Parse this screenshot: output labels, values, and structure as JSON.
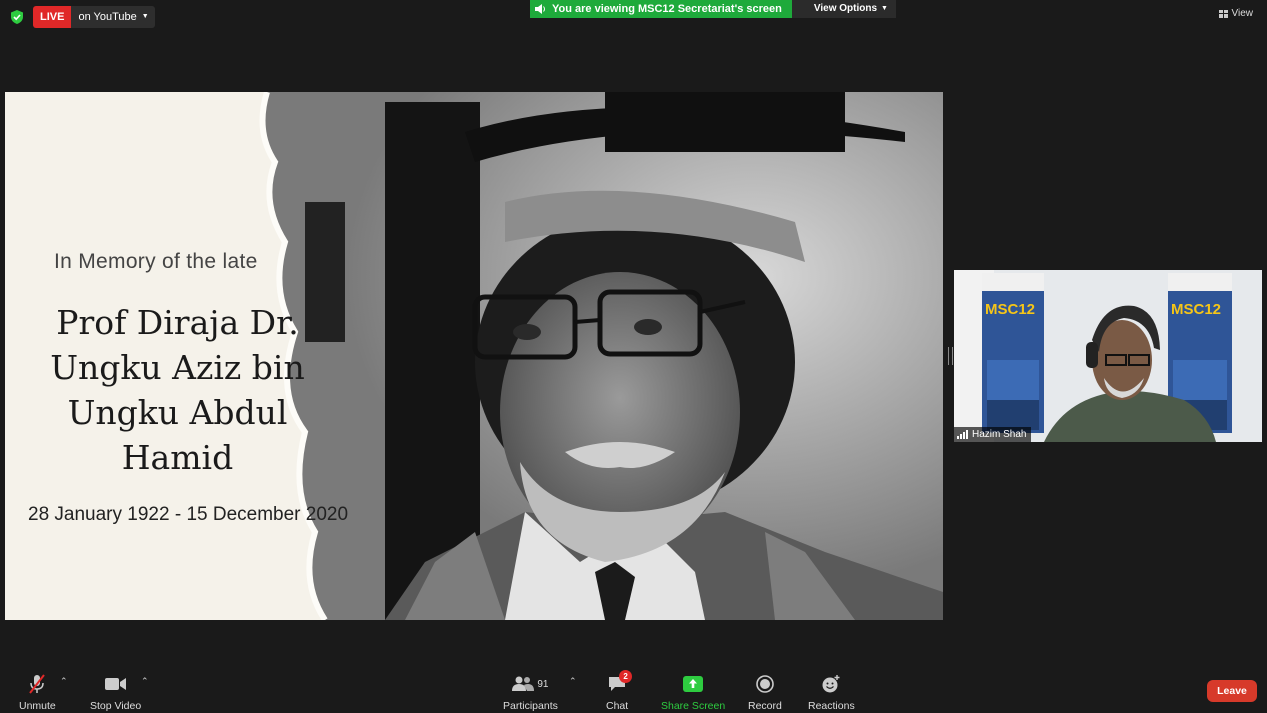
{
  "topbar": {
    "live_label": "LIVE",
    "live_target": "on YouTube",
    "viewing_text": "You are viewing MSC12 Secretariat's screen",
    "view_options": "View Options",
    "view_label": "View"
  },
  "shared_slide": {
    "memory_line": "In Memory of the late",
    "name_lines": [
      "Prof Diraja Dr.",
      "Ungku Aziz bin",
      "Ungku Abdul",
      "Hamid"
    ],
    "dates": "28 January 1922 - 15 December 2020"
  },
  "video_tile": {
    "participant_name": "Hazim Shah",
    "banner_title": "MSC12"
  },
  "toolbar": {
    "unmute": "Unmute",
    "stop_video": "Stop Video",
    "participants": "Participants",
    "participants_count": "91",
    "chat": "Chat",
    "chat_badge": "2",
    "share_screen": "Share Screen",
    "record": "Record",
    "reactions": "Reactions",
    "leave": "Leave"
  },
  "colors": {
    "background": "#1a1a1a",
    "live_red": "#e02828",
    "viewing_green": "#1eaa3b",
    "share_green": "#2ecc40",
    "leave_red": "#d73a2a"
  }
}
